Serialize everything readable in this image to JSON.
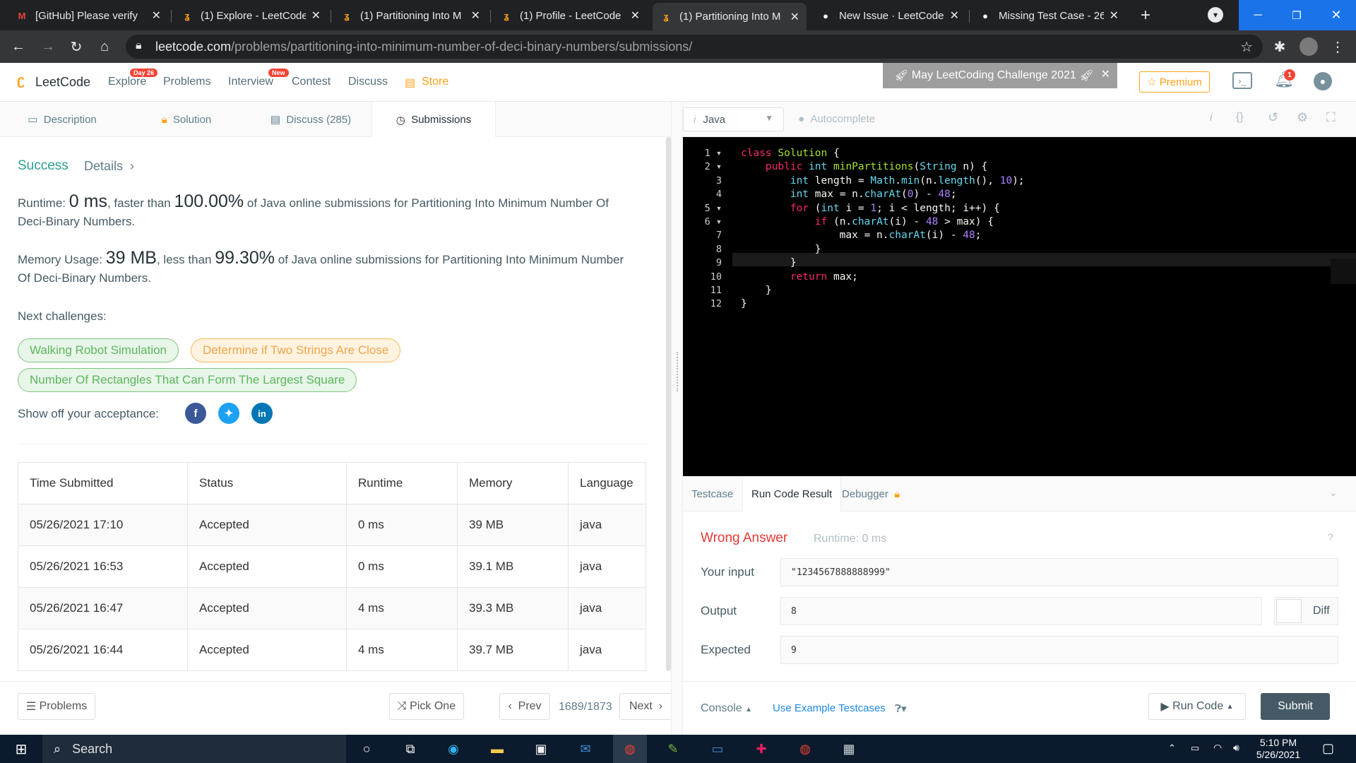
{
  "browser": {
    "tabs": [
      {
        "title": "[GitHub] Please verify",
        "icon": "gmail-icon"
      },
      {
        "title": "(1) Explore - LeetCode",
        "icon": "leetcode-icon"
      },
      {
        "title": "(1) Partitioning Into M",
        "icon": "leetcode-icon"
      },
      {
        "title": "(1) Profile - LeetCode",
        "icon": "leetcode-icon"
      },
      {
        "title": "(1) Partitioning Into M",
        "icon": "leetcode-icon",
        "active": true
      },
      {
        "title": "New Issue · LeetCode",
        "icon": "github-icon"
      },
      {
        "title": "Missing Test Case - 26",
        "icon": "github-icon"
      }
    ],
    "url_host": "leetcode.com",
    "url_path": "/problems/partitioning-into-minimum-number-of-deci-binary-numbers/submissions/"
  },
  "nav": {
    "logo": "LeetCode",
    "explore": "Explore",
    "explore_badge": "Day 26",
    "problems": "Problems",
    "interview": "Interview",
    "interview_badge": "New",
    "contest": "Contest",
    "discuss": "Discuss",
    "store": "Store",
    "banner": "May LeetCoding Challenge 2021",
    "premium": "Premium",
    "notif_count": "1"
  },
  "left_tabs": {
    "description": "Description",
    "solution": "Solution",
    "discuss": "Discuss (285)",
    "submissions": "Submissions"
  },
  "result": {
    "status": "Success",
    "details": "Details",
    "runtime_label": "Runtime:",
    "runtime_value": "0 ms",
    "runtime_mid": ", faster than",
    "runtime_pct": "100.00%",
    "runtime_tail": "of Java online submissions for Partitioning Into Minimum Number Of Deci-Binary Numbers.",
    "memory_label": "Memory Usage:",
    "memory_value": "39 MB",
    "memory_mid": ", less than",
    "memory_pct": "99.30%",
    "memory_tail": "of Java online submissions for Partitioning Into Minimum Number Of Deci-Binary Numbers.",
    "next_challenges": "Next challenges:",
    "challenges": [
      "Walking Robot Simulation",
      "Determine if Two Strings Are Close",
      "Number Of Rectangles That Can Form The Largest Square"
    ],
    "show_off": "Show off your acceptance:"
  },
  "table": {
    "headers": [
      "Time Submitted",
      "Status",
      "Runtime",
      "Memory",
      "Language"
    ],
    "rows": [
      [
        "05/26/2021 17:10",
        "Accepted",
        "0 ms",
        "39 MB",
        "java"
      ],
      [
        "05/26/2021 16:53",
        "Accepted",
        "0 ms",
        "39.1 MB",
        "java"
      ],
      [
        "05/26/2021 16:47",
        "Accepted",
        "4 ms",
        "39.3 MB",
        "java"
      ],
      [
        "05/26/2021 16:44",
        "Accepted",
        "4 ms",
        "39.7 MB",
        "java"
      ]
    ]
  },
  "left_bottom": {
    "problems": "Problems",
    "pick_one": "Pick One",
    "prev": "Prev",
    "page": "1689/1873",
    "next": "Next"
  },
  "editor": {
    "language": "Java",
    "autocomplete": "Autocomplete",
    "lines": [
      [
        [
          "kw",
          "class"
        ],
        [
          "t",
          " "
        ],
        [
          "fn",
          "Solution"
        ],
        [
          "t",
          " {"
        ]
      ],
      [
        [
          "t",
          "    "
        ],
        [
          "kw",
          "public"
        ],
        [
          "t",
          " "
        ],
        [
          "ty",
          "int"
        ],
        [
          "t",
          " "
        ],
        [
          "fn",
          "minPartitions"
        ],
        [
          "t",
          "("
        ],
        [
          "ty",
          "String"
        ],
        [
          "t",
          " n) {"
        ]
      ],
      [
        [
          "t",
          "        "
        ],
        [
          "ty",
          "int"
        ],
        [
          "t",
          " length = "
        ],
        [
          "ty",
          "Math"
        ],
        [
          "t",
          "."
        ],
        [
          "ty",
          "min"
        ],
        [
          "t",
          "(n."
        ],
        [
          "ty",
          "length"
        ],
        [
          "t",
          "(), "
        ],
        [
          "nm",
          "10"
        ],
        [
          "t",
          ");"
        ]
      ],
      [
        [
          "t",
          "        "
        ],
        [
          "ty",
          "int"
        ],
        [
          "t",
          " max = n."
        ],
        [
          "ty",
          "charAt"
        ],
        [
          "t",
          "("
        ],
        [
          "nm",
          "0"
        ],
        [
          "t",
          ") - "
        ],
        [
          "nm",
          "48"
        ],
        [
          "t",
          ";"
        ]
      ],
      [
        [
          "t",
          "        "
        ],
        [
          "kw",
          "for"
        ],
        [
          "t",
          " ("
        ],
        [
          "ty",
          "int"
        ],
        [
          "t",
          " i = "
        ],
        [
          "nm",
          "1"
        ],
        [
          "t",
          "; i < length; i++) {"
        ]
      ],
      [
        [
          "t",
          "            "
        ],
        [
          "kw",
          "if"
        ],
        [
          "t",
          " (n."
        ],
        [
          "ty",
          "charAt"
        ],
        [
          "t",
          "(i) - "
        ],
        [
          "nm",
          "48"
        ],
        [
          "t",
          " > max) {"
        ]
      ],
      [
        [
          "t",
          "                max = n."
        ],
        [
          "ty",
          "charAt"
        ],
        [
          "t",
          "(i) - "
        ],
        [
          "nm",
          "48"
        ],
        [
          "t",
          ";"
        ]
      ],
      [
        [
          "t",
          "            }"
        ]
      ],
      [
        [
          "t",
          "        }"
        ]
      ],
      [
        [
          "t",
          "        "
        ],
        [
          "kw",
          "return"
        ],
        [
          "t",
          " max;"
        ]
      ],
      [
        [
          "t",
          "    }"
        ]
      ],
      [
        [
          "t",
          "}"
        ]
      ]
    ],
    "line_numbers": [
      "1",
      "2",
      "3",
      "4",
      "5",
      "6",
      "7",
      "8",
      "9",
      "10",
      "11",
      "12"
    ],
    "fold_lines": [
      0,
      1,
      4,
      5
    ]
  },
  "result_tabs": {
    "testcase": "Testcase",
    "run_code_result": "Run Code Result",
    "debugger": "Debugger"
  },
  "run_result": {
    "status": "Wrong Answer",
    "runtime": "Runtime: 0 ms",
    "input_label": "Your input",
    "input_value": "\"1234567888888999\"",
    "output_label": "Output",
    "output_value": "8",
    "expected_label": "Expected",
    "expected_value": "9",
    "diff": "Diff"
  },
  "right_bottom": {
    "console": "Console",
    "use_example": "Use Example Testcases",
    "run_code": "Run Code",
    "submit": "Submit"
  },
  "taskbar": {
    "search": "Search",
    "time": "5:10 PM",
    "date": "5/26/2021"
  },
  "colors": {
    "success": "#2e9e8f",
    "accepted": "#43a047",
    "wrong": "#e53935",
    "accent": "#ffa116",
    "submit": "#455a64"
  }
}
